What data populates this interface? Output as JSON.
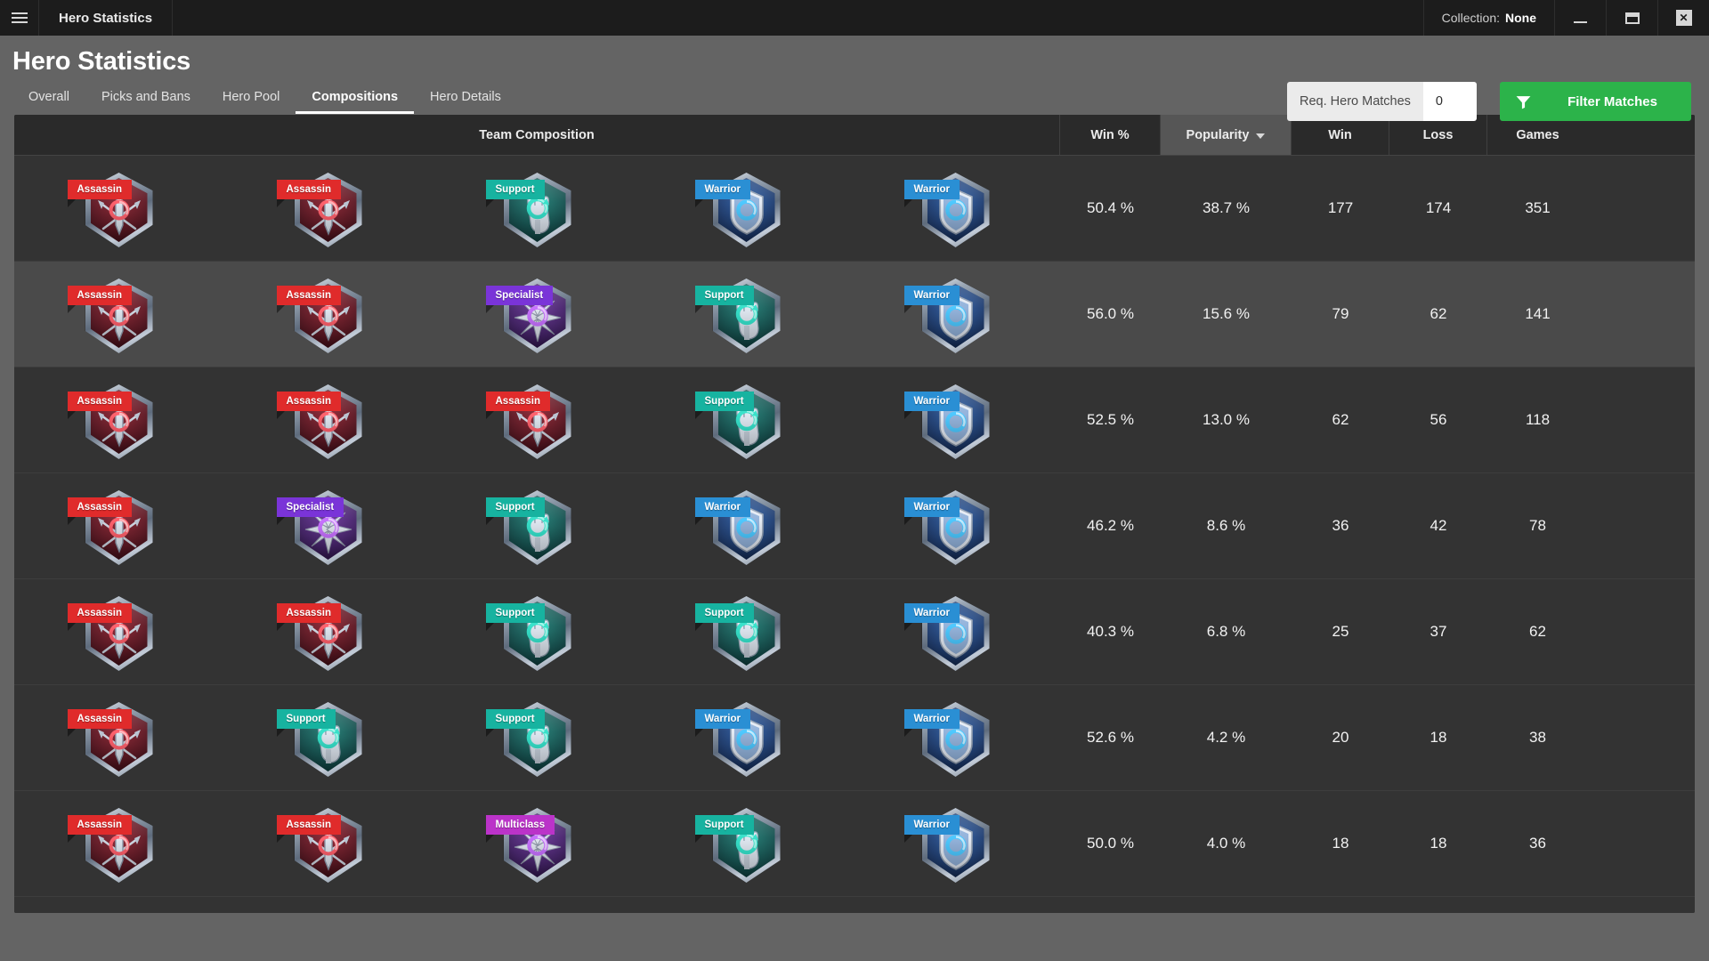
{
  "titlebar": {
    "hamburger_icon": "hamburger-menu-icon",
    "app_title": "Hero Statistics",
    "collection_label": "Collection:",
    "collection_value": "None",
    "minimize_icon": "minimize-icon",
    "maximize_icon": "maximize-icon",
    "close_icon": "close-icon",
    "close_glyph": "✕"
  },
  "header": {
    "page_title": "Hero Statistics",
    "tabs": [
      {
        "label": "Overall",
        "active": false
      },
      {
        "label": "Picks and Bans",
        "active": false
      },
      {
        "label": "Hero Pool",
        "active": false
      },
      {
        "label": "Compositions",
        "active": true
      },
      {
        "label": "Hero Details",
        "active": false
      }
    ],
    "req_hero_matches": {
      "label": "Req. Hero Matches",
      "value": "0",
      "placeholder": "0"
    },
    "filter_button": {
      "label": "Filter Matches",
      "icon": "filter-funnel-icon",
      "color": "#2cb34a"
    }
  },
  "table": {
    "columns": [
      {
        "key": "composition",
        "label": "Team Composition",
        "sorted": false
      },
      {
        "key": "win_pct",
        "label": "Win %",
        "sorted": false
      },
      {
        "key": "popularity",
        "label": "Popularity",
        "sorted": true,
        "sort_dir": "desc"
      },
      {
        "key": "win",
        "label": "Win",
        "sorted": false
      },
      {
        "key": "loss",
        "label": "Loss",
        "sorted": false
      },
      {
        "key": "games",
        "label": "Games",
        "sorted": false
      }
    ],
    "role_colors": {
      "Assassin": "#e02b2b",
      "Support": "#17b3a0",
      "Warrior": "#2a8fd4",
      "Specialist": "#7a34d8",
      "Multiclass": "#bb33c9"
    },
    "rows": [
      {
        "composition": [
          "Assassin",
          "Assassin",
          "Support",
          "Warrior",
          "Warrior"
        ],
        "win_pct": "50.4 %",
        "popularity": "38.7 %",
        "win": "177",
        "loss": "174",
        "games": "351"
      },
      {
        "composition": [
          "Assassin",
          "Assassin",
          "Specialist",
          "Support",
          "Warrior"
        ],
        "win_pct": "56.0 %",
        "popularity": "15.6 %",
        "win": "79",
        "loss": "62",
        "games": "141"
      },
      {
        "composition": [
          "Assassin",
          "Assassin",
          "Assassin",
          "Support",
          "Warrior"
        ],
        "win_pct": "52.5 %",
        "popularity": "13.0 %",
        "win": "62",
        "loss": "56",
        "games": "118"
      },
      {
        "composition": [
          "Assassin",
          "Specialist",
          "Support",
          "Warrior",
          "Warrior"
        ],
        "win_pct": "46.2 %",
        "popularity": "8.6 %",
        "win": "36",
        "loss": "42",
        "games": "78"
      },
      {
        "composition": [
          "Assassin",
          "Assassin",
          "Support",
          "Support",
          "Warrior"
        ],
        "win_pct": "40.3 %",
        "popularity": "6.8 %",
        "win": "25",
        "loss": "37",
        "games": "62"
      },
      {
        "composition": [
          "Assassin",
          "Support",
          "Support",
          "Warrior",
          "Warrior"
        ],
        "win_pct": "52.6 %",
        "popularity": "4.2 %",
        "win": "20",
        "loss": "18",
        "games": "38"
      },
      {
        "composition": [
          "Assassin",
          "Assassin",
          "Multiclass",
          "Support",
          "Warrior"
        ],
        "win_pct": "50.0 %",
        "popularity": "4.0 %",
        "win": "18",
        "loss": "18",
        "games": "36"
      }
    ]
  }
}
